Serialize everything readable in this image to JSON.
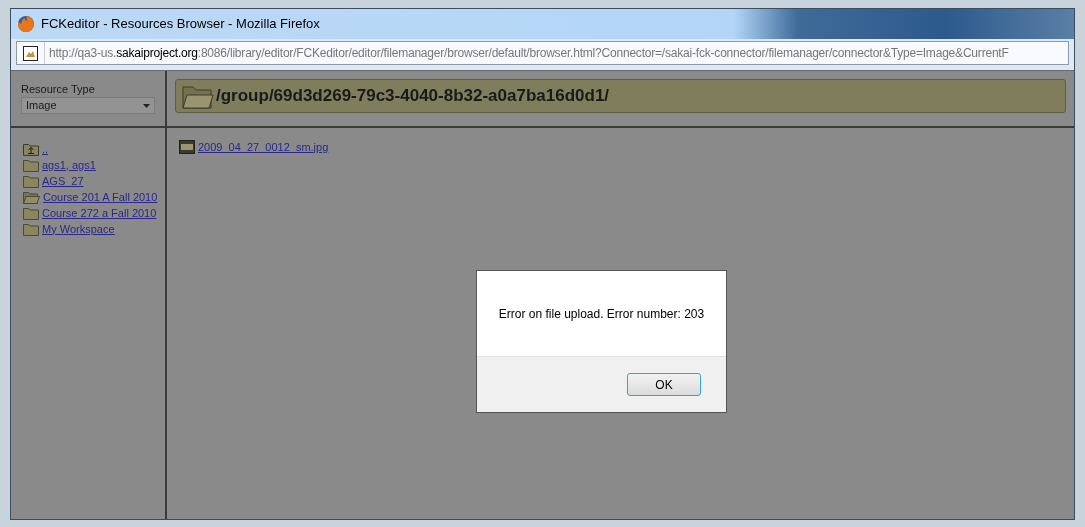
{
  "window": {
    "title": "FCKeditor - Resources Browser - Mozilla Firefox"
  },
  "address_bar": {
    "url": "http://qa3-us.**sakaiproject.org**:8086/library/editor/FCKeditor/editor/filemanager/browser/default/browser.html?Connector=/sakai-fck-connector/filemanager/connector&Type=Image&CurrentF"
  },
  "resource_type": {
    "label": "Resource Type",
    "value": "Image"
  },
  "folders": [
    {
      "kind": "up",
      "name": ".."
    },
    {
      "kind": "folder",
      "name": "ags1, ags1"
    },
    {
      "kind": "folder",
      "name": "AGS_27"
    },
    {
      "kind": "open-folder",
      "name": "Course 201 A Fall 2010"
    },
    {
      "kind": "folder",
      "name": "Course 272 a Fall 2010"
    },
    {
      "kind": "folder",
      "name": "My Workspace"
    }
  ],
  "current_path": "/group/69d3d269-79c3-4040-8b32-a0a7ba16d0d1/",
  "files": [
    {
      "name": "2009_04_27_0012_sm.jpg"
    }
  ],
  "dialog": {
    "message": "Error on file upload. Error number: 203",
    "button": "OK"
  }
}
